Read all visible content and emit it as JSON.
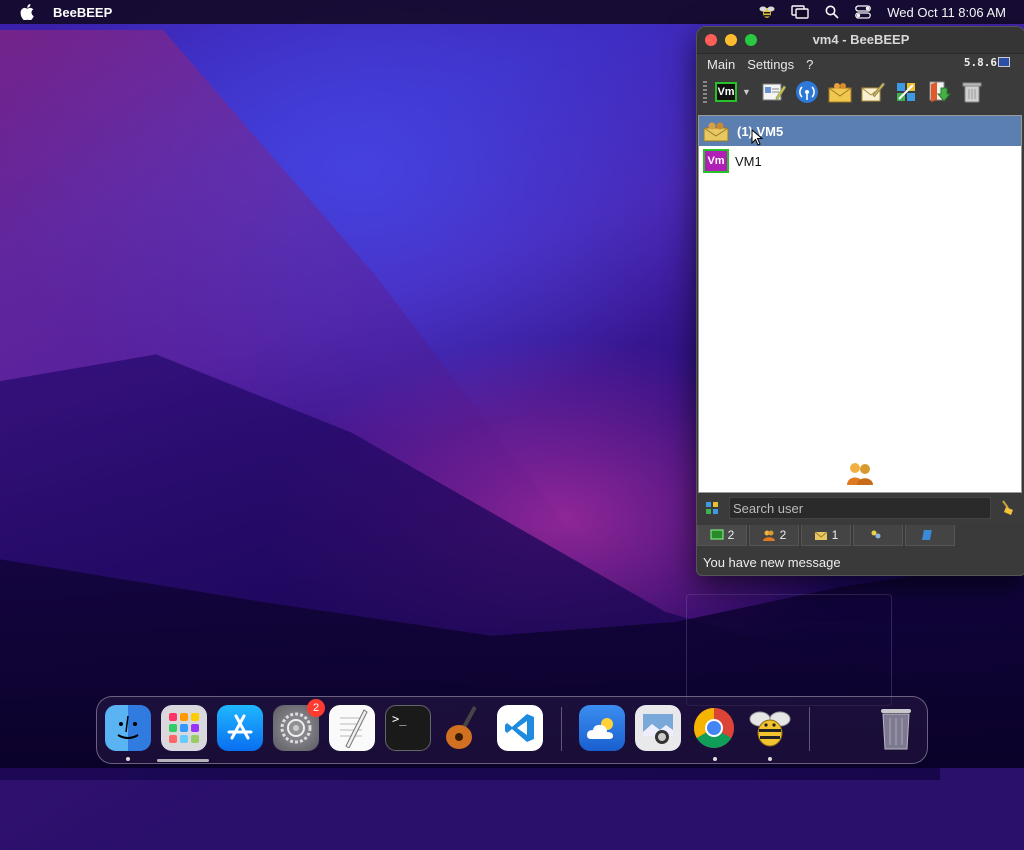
{
  "menubar": {
    "app_name": "BeeBEEP",
    "clock": "Wed Oct 11  8:06 AM"
  },
  "window": {
    "title": "vm4 - BeeBEEP",
    "menus": [
      "Main",
      "Settings",
      "?"
    ],
    "version": "5.8.6",
    "toolbar_badge": "Vm",
    "users": [
      {
        "label": "(1) VM5",
        "selected": true
      },
      {
        "label": "VM1",
        "badge": "Vm",
        "selected": false
      }
    ],
    "search_placeholder": "Search user",
    "tabs": [
      {
        "count": "2"
      },
      {
        "count": "2"
      },
      {
        "count": "1"
      },
      {
        "count": ""
      },
      {
        "count": ""
      }
    ],
    "status": "You have new message"
  },
  "dock": {
    "settings_badge": "2",
    "apps": [
      "finder-icon",
      "launchpad-icon",
      "app-store-icon",
      "system-settings-icon",
      "textedit-icon",
      "terminal-icon",
      "garageband-icon",
      "vscode-icon",
      "weather-icon",
      "preview-icon",
      "chrome-icon",
      "beebeep-icon",
      "trash-icon"
    ]
  }
}
